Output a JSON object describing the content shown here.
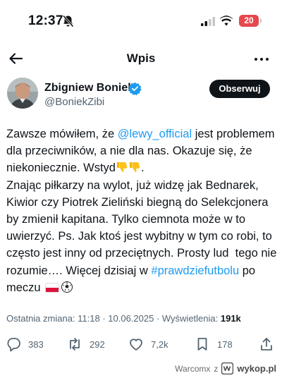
{
  "status_bar": {
    "time": "12:37",
    "battery": "20",
    "battery_color": "#e5484d"
  },
  "header": {
    "title": "Wpis",
    "back_icon": "arrow-left-icon",
    "more_icon": "more-dots-icon"
  },
  "author": {
    "name": "Zbigniew Boniek",
    "handle": "@BoniekZibi",
    "verified": true,
    "follow_label": "Obserwuj"
  },
  "tweet": {
    "p1": "Zawsze mówiłem, że ",
    "mention": "@lewy_official",
    "p2": " jest problemem dla przeciwników, a nie dla nas. Okazuje się, że niekoniecznie. Wstyd",
    "p3": ".\nZnając piłkarzy na wylot, już widzę jak Bednarek, Kiwior czy Piotrek Zieliński biegną do Selekcjonera by zmienił kapitana. Tylko ciemnota może w to uwierzyć. Ps. Jak ktoś jest wybitny w tym co robi, to często jest inny od przeciętnych. Prosty lud  tego nie rozumie…. Więcej dzisiaj w ",
    "hashtag": "#prawdziefutbolu",
    "p4": " po meczu "
  },
  "meta": {
    "edited": "Ostatnia zmiana: 11:18 · 10.06.2025 · Wyświetlenia: ",
    "views": "191k"
  },
  "actions": {
    "replies": "383",
    "reposts": "292",
    "likes": "7,2k",
    "bookmarks": "178"
  },
  "watermark": {
    "user": "Warcomx",
    "z": "z",
    "site": "wykop.pl"
  },
  "colors": {
    "link": "#1d9bf0",
    "text": "#0f1419",
    "muted": "#536471"
  }
}
